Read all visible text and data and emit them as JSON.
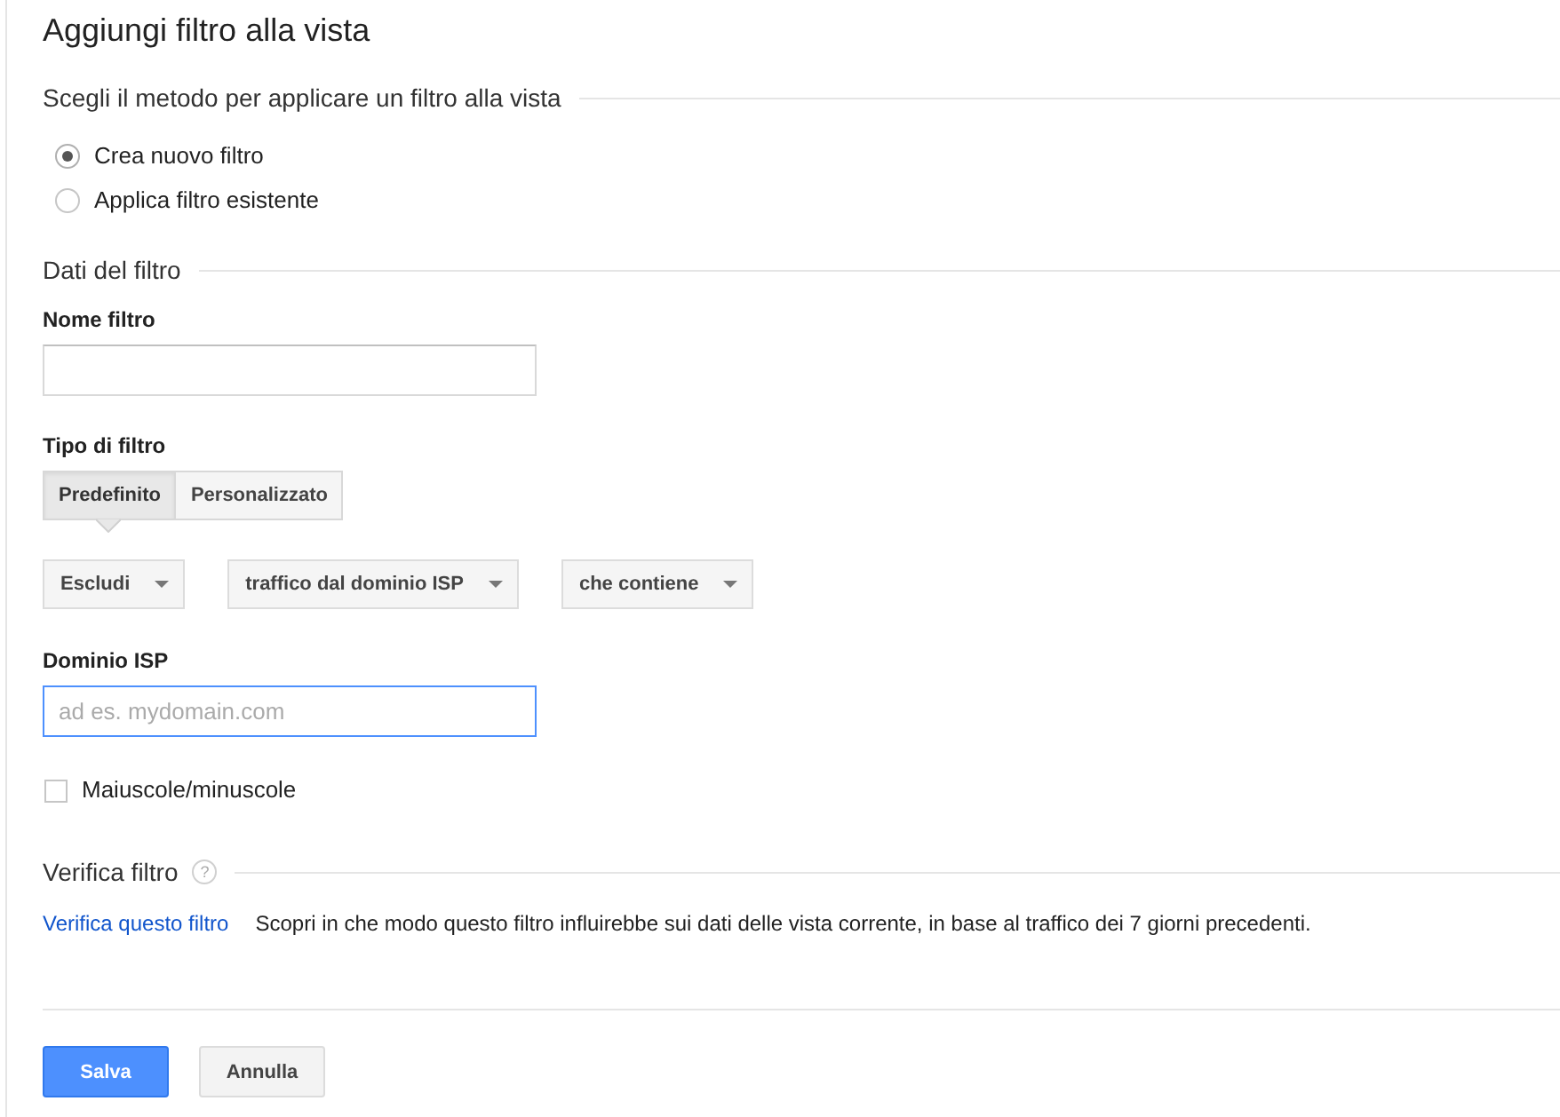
{
  "title": "Aggiungi filtro alla vista",
  "method_section": {
    "heading": "Scegli il metodo per applicare un filtro alla vista",
    "options": [
      {
        "label": "Crea nuovo filtro",
        "selected": true
      },
      {
        "label": "Applica filtro esistente",
        "selected": false
      }
    ]
  },
  "filter_section": {
    "heading": "Dati del filtro",
    "name_field": {
      "label": "Nome filtro"
    },
    "type_label": "Tipo di filtro",
    "type_tabs": [
      {
        "label": "Predefinito",
        "selected": true
      },
      {
        "label": "Personalizzato",
        "selected": false
      }
    ],
    "dropdowns": [
      {
        "value": "Escludi"
      },
      {
        "value": "traffico dal dominio ISP"
      },
      {
        "value": "che contiene"
      }
    ],
    "domain_field": {
      "label": "Dominio ISP",
      "placeholder": "ad es. mydomain.com",
      "focused": true
    },
    "case_checkbox": {
      "label": "Maiuscole/minuscole",
      "checked": false
    }
  },
  "verify_section": {
    "heading": "Verifica filtro",
    "help": "?",
    "link": "Verifica questo filtro",
    "description": "Scopri in che modo questo filtro influirebbe sui dati delle vista corrente, in base al traffico dei 7 giorni precedenti."
  },
  "buttons": [
    {
      "label": "Salva",
      "kind": "primary"
    },
    {
      "label": "Annulla",
      "kind": "secondary"
    }
  ]
}
